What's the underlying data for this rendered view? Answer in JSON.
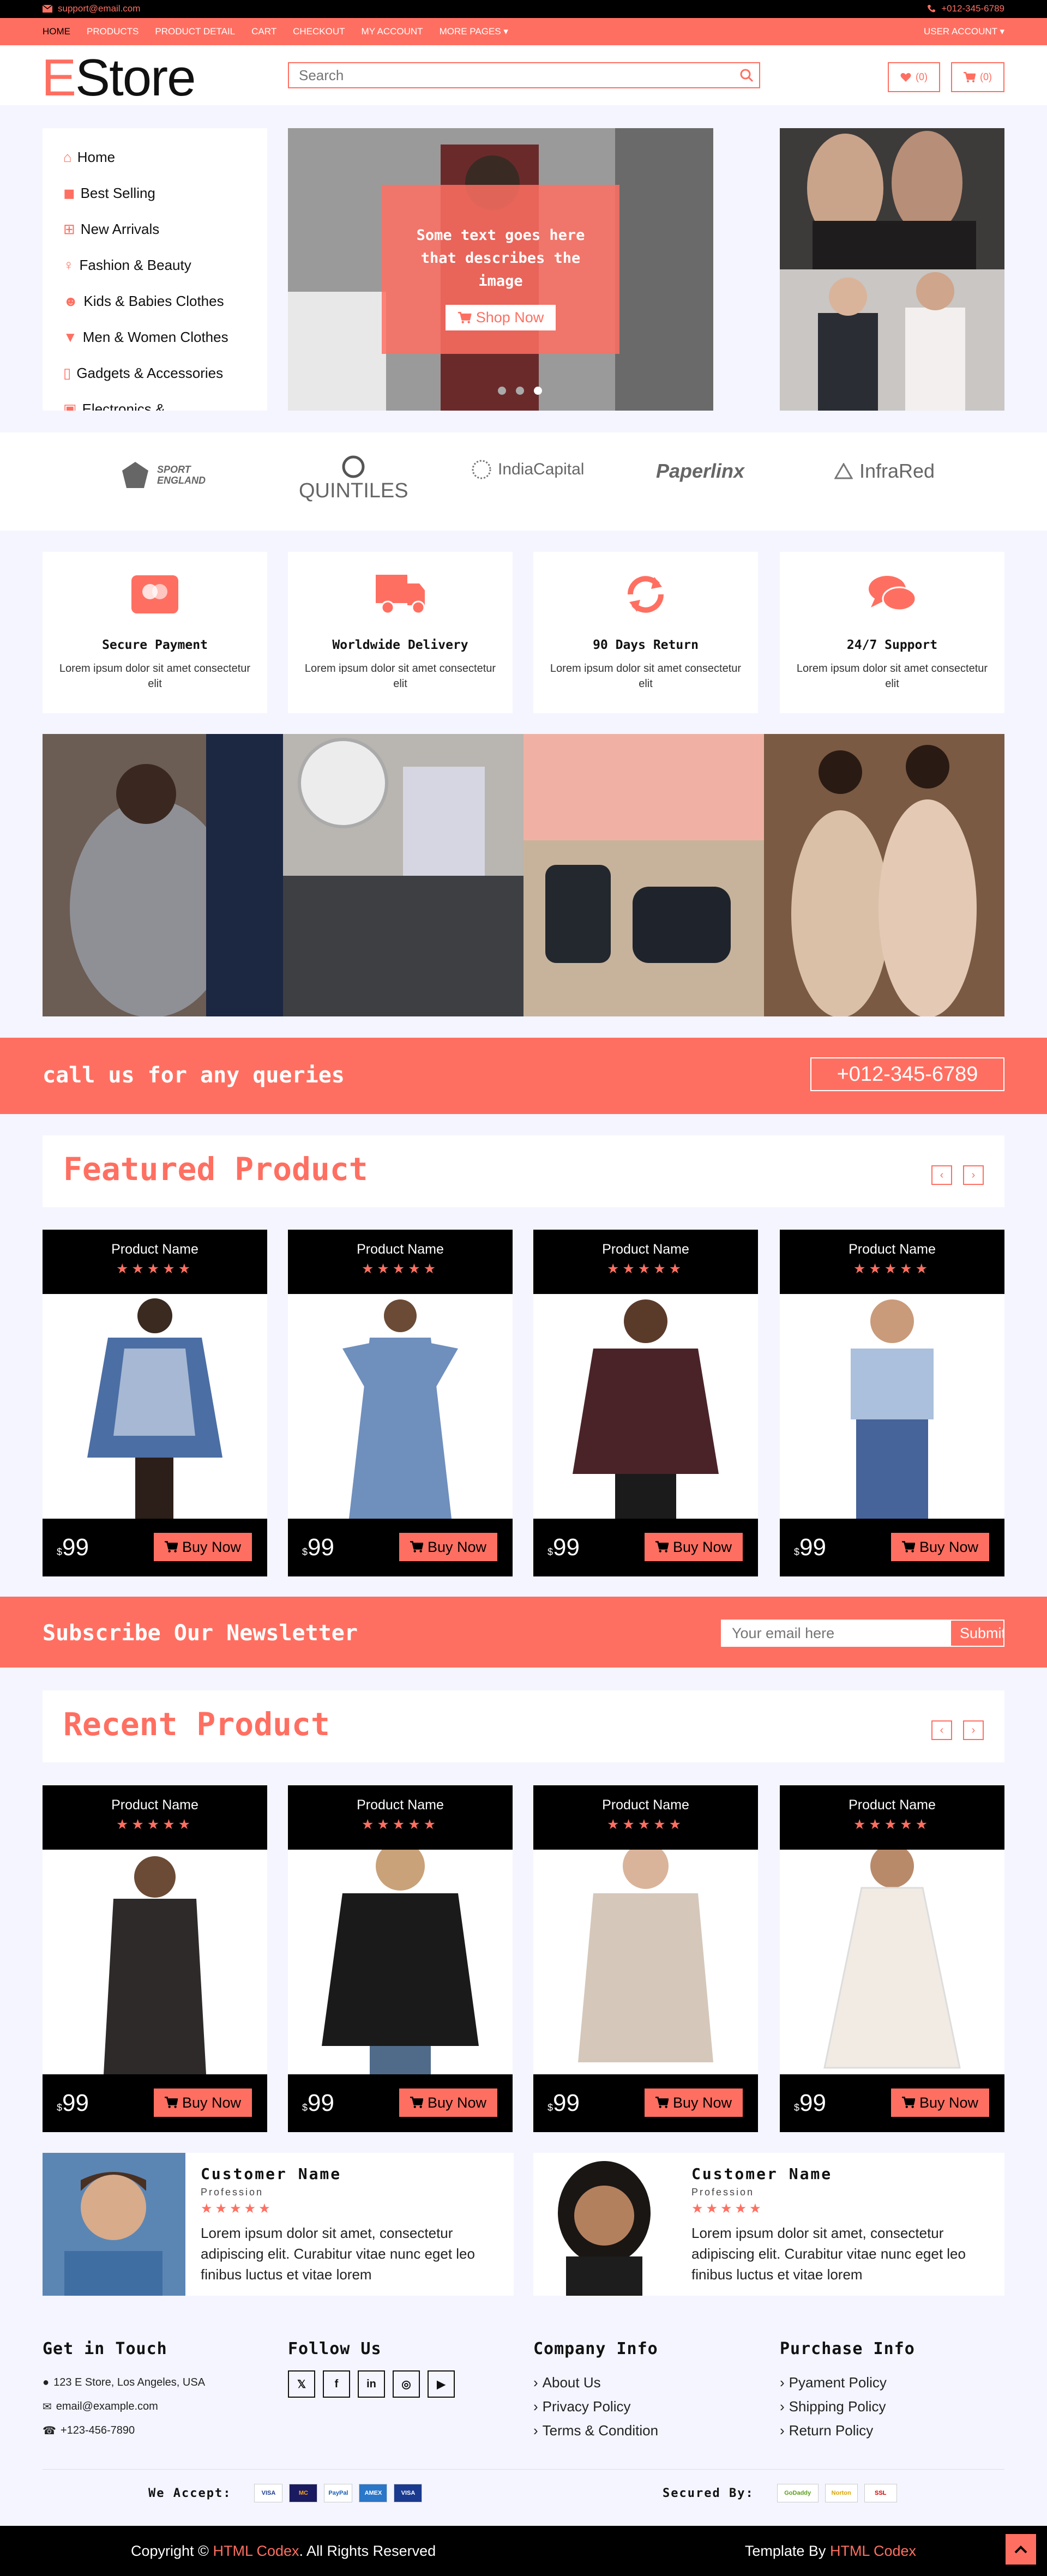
{
  "topbar": {
    "email": "support@email.com",
    "phone": "+012-345-6789"
  },
  "nav": {
    "items": [
      "Home",
      "Products",
      "Product Detail",
      "Cart",
      "Checkout",
      "My Account",
      "More Pages"
    ],
    "user_account": "User Account"
  },
  "header": {
    "logo_letter": "E",
    "logo_rest": "Store",
    "search_placeholder": "Search",
    "wishlist_count": "(0)",
    "cart_count": "(0)"
  },
  "sidebar": {
    "items": [
      "Home",
      "Best Selling",
      "New Arrivals",
      "Fashion & Beauty",
      "Kids & Babies Clothes",
      "Men & Women Clothes",
      "Gadgets & Accessories",
      "Electronics &"
    ]
  },
  "hero": {
    "text": "Some text goes here that describes the image",
    "button": "Shop Now"
  },
  "brands": [
    "SPORT ENGLAND",
    "QUINTILES",
    "IndiaCapital",
    "Paperlinx",
    "InfraRed"
  ],
  "features": [
    {
      "title": "Secure Payment",
      "text": "Lorem ipsum dolor sit amet consectetur elit",
      "icon": "credit-card-icon"
    },
    {
      "title": "Worldwide Delivery",
      "text": "Lorem ipsum dolor sit amet consectetur elit",
      "icon": "truck-icon"
    },
    {
      "title": "90 Days Return",
      "text": "Lorem ipsum dolor sit amet consectetur elit",
      "icon": "sync-icon"
    },
    {
      "title": "24/7 Support",
      "text": "Lorem ipsum dolor sit amet consectetur elit",
      "icon": "chat-icon"
    }
  ],
  "call": {
    "text": "call us for any queries",
    "phone": "+012-345-6789"
  },
  "featured": {
    "title": "Featured Product",
    "products": [
      {
        "name": "Product Name",
        "stars": "★★★★★",
        "currency": "$",
        "price": "99",
        "buy": "Buy Now"
      },
      {
        "name": "Product Name",
        "stars": "★★★★★",
        "currency": "$",
        "price": "99",
        "buy": "Buy Now"
      },
      {
        "name": "Product Name",
        "stars": "★★★★★",
        "currency": "$",
        "price": "99",
        "buy": "Buy Now"
      },
      {
        "name": "Product Name",
        "stars": "★★★★★",
        "currency": "$",
        "price": "99",
        "buy": "Buy Now"
      }
    ]
  },
  "newsletter": {
    "title": "Subscribe Our Newsletter",
    "placeholder": "Your email here",
    "button": "Submit"
  },
  "recent": {
    "title": "Recent Product",
    "products": [
      {
        "name": "Product Name",
        "stars": "★★★★★",
        "currency": "$",
        "price": "99",
        "buy": "Buy Now"
      },
      {
        "name": "Product Name",
        "stars": "★★★★★",
        "currency": "$",
        "price": "99",
        "buy": "Buy Now"
      },
      {
        "name": "Product Name",
        "stars": "★★★★★",
        "currency": "$",
        "price": "99",
        "buy": "Buy Now"
      },
      {
        "name": "Product Name",
        "stars": "★★★★★",
        "currency": "$",
        "price": "99",
        "buy": "Buy Now"
      }
    ]
  },
  "testimonials": [
    {
      "name": "Customer Name",
      "profession": "Profession",
      "stars": "★★★★★",
      "text": "Lorem ipsum dolor sit amet, consectetur adipiscing elit. Curabitur vitae nunc eget leo finibus luctus et vitae lorem"
    },
    {
      "name": "Customer Name",
      "profession": "Profession",
      "stars": "★★★★★",
      "text": "Lorem ipsum dolor sit amet, consectetur adipiscing elit. Curabitur vitae nunc eget leo finibus luctus et vitae lorem"
    }
  ],
  "footer": {
    "contact": {
      "title": "Get in Touch",
      "address": "123 E Store, Los Angeles, USA",
      "email": "email@example.com",
      "phone": "+123-456-7890"
    },
    "follow": {
      "title": "Follow Us",
      "networks": [
        "twitter",
        "facebook",
        "linkedin",
        "instagram",
        "youtube"
      ]
    },
    "company": {
      "title": "Company Info",
      "links": [
        "About Us",
        "Privacy Policy",
        "Terms & Condition"
      ]
    },
    "purchase": {
      "title": "Purchase Info",
      "links": [
        "Pyament Policy",
        "Shipping Policy",
        "Return Policy"
      ]
    },
    "accept_label": "We Accept:",
    "secured_label": "Secured By:",
    "cards": [
      "VISA",
      "MC",
      "PayPal",
      "AMEX",
      "VISA"
    ],
    "seals": [
      "GoDaddy",
      "Norton",
      "SSL"
    ]
  },
  "bottom": {
    "copyright_prefix": "Copyright ©",
    "copyright_brand": "HTML Codex",
    "copyright_suffix": ". All Rights Reserved",
    "template_prefix": "Template By",
    "template_brand": "HTML Codex"
  },
  "colors": {
    "accent": "#ff6f61",
    "dark": "#000000",
    "bg": "#f4f5ff"
  }
}
